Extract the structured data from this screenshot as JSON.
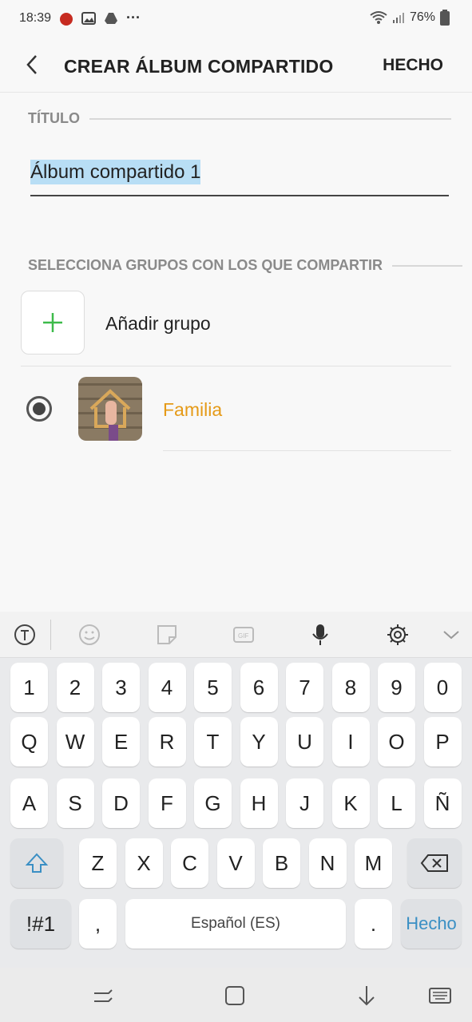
{
  "status_bar": {
    "time": "18:39",
    "battery": "76%"
  },
  "app_bar": {
    "title": "CREAR ÁLBUM COMPARTIDO",
    "done_label": "HECHO"
  },
  "title_section": {
    "header": "TÍTULO",
    "value": "Álbum compartido 1"
  },
  "groups_section": {
    "header": "SELECCIONA GRUPOS CON LOS QUE COMPARTIR",
    "add_label": "Añadir grupo",
    "groups": [
      {
        "name": "Familia",
        "selected": true
      }
    ]
  },
  "keyboard": {
    "number_row": [
      "1",
      "2",
      "3",
      "4",
      "5",
      "6",
      "7",
      "8",
      "9",
      "0"
    ],
    "row1": [
      "Q",
      "W",
      "E",
      "R",
      "T",
      "Y",
      "U",
      "I",
      "O",
      "P"
    ],
    "row2": [
      "A",
      "S",
      "D",
      "F",
      "G",
      "H",
      "J",
      "K",
      "L",
      "Ñ"
    ],
    "row3": [
      "Z",
      "X",
      "C",
      "V",
      "B",
      "N",
      "M"
    ],
    "symbols_label": "!#1",
    "comma": ",",
    "space_label": "Español (ES)",
    "period": ".",
    "enter_label": "Hecho",
    "toolbar_icons": [
      "text-translate-icon",
      "emoji-icon",
      "sticker-icon",
      "gif-icon",
      "microphone-icon",
      "settings-icon",
      "collapse-icon"
    ]
  },
  "colors": {
    "accent_green": "#3dbb4a",
    "group_name": "#e59a17",
    "enter_blue": "#3a8fc4",
    "selection": "#b8def5"
  }
}
